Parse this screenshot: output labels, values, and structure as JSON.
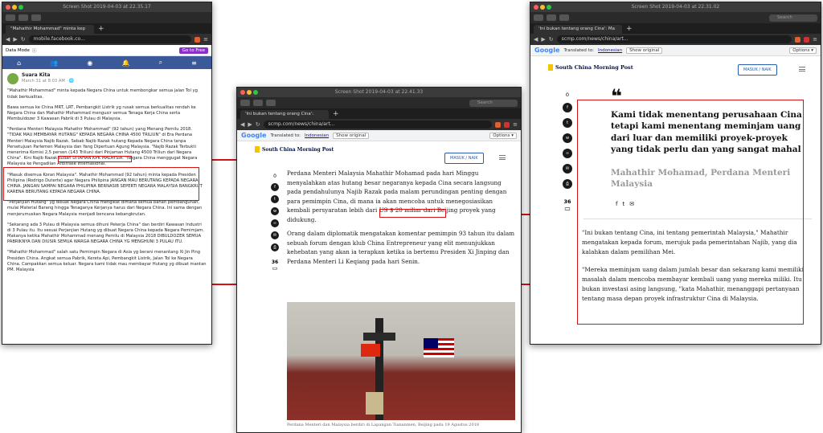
{
  "windows": {
    "left": {
      "title": "Screen Shot 2019-04-03 at 22.35.17",
      "tab": "\"Mahathir Mohammad\" minta kep",
      "url": "mobile.facebook.co...",
      "data_mode": "Data Mode",
      "go_free": "Go to Free",
      "notif_badge": "3",
      "fb_badge": "9+"
    },
    "middle": {
      "title": "Screen Shot 2019-04-03 at 22.41.33",
      "tab": "'Ini bukan tentang orang Cina':",
      "url": "scmp.com/news/china/art...",
      "translated": "Translated to:",
      "lang": "Indonesian",
      "show_original": "Show original",
      "options": "Options ▾"
    },
    "right": {
      "title": "Screen Shot 2019-04-03 at 22.31.02",
      "tab": "'Ini bukan tentang orang Cina': Ma",
      "url": "scmp.com/news/china/art...",
      "translated": "Translated to:",
      "lang": "Indonesian",
      "show_original": "Show original",
      "options": "Options ▾"
    }
  },
  "search_placeholder": "Search",
  "google": "Google",
  "scmp_name": "South China Morning Post",
  "masuk": "MASUK / NAIK",
  "fb": {
    "author": "Suara Kita",
    "date": "March 31 at 8:03 AM · 🌐",
    "paragraphs": [
      "\"Mahathir Mohammad\" minta kepada Negara China untuk membongkar semua jalan Tol yg tidak berkualitas.",
      "Bawa semua ke China MRT, LRT, Pembangkit Listrik yg rusak semua berkualitas rendah ke Negara China dan Mahathir Mohammad mengusir semua Tenaga Kerja China serta Membuldozer 3 Kawasan Pabrik di 3 Pulau di Malaysia.",
      "\"Perdana Menteri Malaysia Mahathir Mohammad\" (92 tahun) yang Menang Pemilu 2018. \"TIDAK MAU MEMBAYAR HUTANG\" KEPADA NEGARA CHINA 4500 TRILIUN\" di Era Perdana Menteri Malaysia Najib Razak. Sebab Najib Razak hutang Kepada Negara China tanpa Persetujuan Parlemen Malaysia dan Yang Dipertuan Agung Malaysia. \"Najib Razak Terbukti menerima Komisi 2,5 persen (143 Triliun) dari Pinjaman Hutang 4500 Triliun dari Negara China\". Kini Najib Razak sudah DITAHAN KPK MALAYSIA. \"Negara China menggugat Negara Malaysia ke Pengadilan Arbitrase Internasional.",
      "\"Masuk disemua Koran Malaysia\". Mahathir Mohammad (92 tahun) minta kepada Presiden Philipina (Rodrigo Duterte) agar Negara Philipina JANGAN MAU BERUTANG KEPADA NEGARA CHINA. JANGAN SAMPAI NEGARA PHILIPINA BERNASIB SEPERTI NEGARA MALAYSIA BANGKRUT KARENA BERUTANG KEPADA NEGARA CHINA.",
      "\"Perjanjian Hutang\" yg dibuat Negara China mengikat dimana semua bahan pembangunan, mulai Material Barang hingga Tenaganya Kerjanya harus dari Negara China. Ini sama dengan menjerumuskan Negara Malaysia menjadi bencana kebangkrutan.",
      "\"Sekarang ada 3 Pulau di Malaysia semua dihuni Pekerja China\" dan berdiri Kawasan Industri di 3 Pulau itu. Itu sesuai Perjanjian Hutang yg dibuat Negara China kepada Negara Pemimjam. Makanya ketika Mahathir Mohammad menang Pemilu di Malaysia 2018 DIBULDOZER SEMUA PABRIKNYA DAN DIUSIR SEMUA WARGA NEGARA CHINA YG MENGHUNI 3 PULAU ITU.",
      "\"Mahathir Mohammad\" salah satu Pemimpin Negara di Asia yg berani menantang Xi Jin Ping Presiden China. Angkat semua Pabrik, Kereta Api, Pembangkit Listrik, Jalan Tol ke Negara China. Campakkan semua keluar. Negara kami tidak mau membayar Hutang yg dibuat mantan PM. Malaysia"
    ]
  },
  "mid_article": {
    "count": "0",
    "comments": "36",
    "p1": "Perdana Menteri Malaysia Mahathir Mohamad pada hari Minggu menyalahkan atas hutang besar negaranya kepada Cina secara langsung pada pendahulunya Najib Razak pada malam perundingan penting dengan para pemimpin Cina, di mana ia akan mencoba untuk menegosiasikan kembali persyaratan lebih dari US $ 20 miliar dari Beijing proyek yang didukung.",
    "p2": "Orang dalam diplomatik mengatakan komentar pemimpin 93 tahun itu dalam sebuah forum dengan klub China Entrepreneur yang elit menunjukkan kehebatan yang akan ia terapkan ketika ia bertemu Presiden Xi Jinping dan Perdana Menteri Li Keqiang pada hari Senin.",
    "caption": "Perdana Menteri dan Malaysia berdiri di Lapangan Tiananmen, Beijing pada 19 Agustus 2018"
  },
  "right_article": {
    "count": "0",
    "comments": "36",
    "quote": "Kami tidak menentang perusahaan Cina tetapi kami menentang meminjam uang dari luar dan memiliki proyek-proyek yang tidak perlu dan yang sangat mahal",
    "attrib": "Mahathir Mohamad, Perdana Menteri Malaysia",
    "p1": "\"Ini bukan tentang Cina, ini tentang pemerintah Malaysia,\" Mahathir mengatakan kepada forum, merujuk pada pemerintahan Najib, yang dia kalahkan dalam pemilihan Mei.",
    "p2": "\"Mereka meminjam uang dalam jumlah besar dan sekarang kami memiliki masalah dalam mencoba membayar kembali uang yang mereka miliki. Itu bukan investasi asing langsung, \"kata Mahathir, menanggapi pertanyaan tentang masa depan proyek infrastruktur Cina di Malaysia."
  },
  "colors": {
    "red": "#d21414",
    "fb_blue": "#3b5998",
    "scmp_navy": "#001246"
  }
}
